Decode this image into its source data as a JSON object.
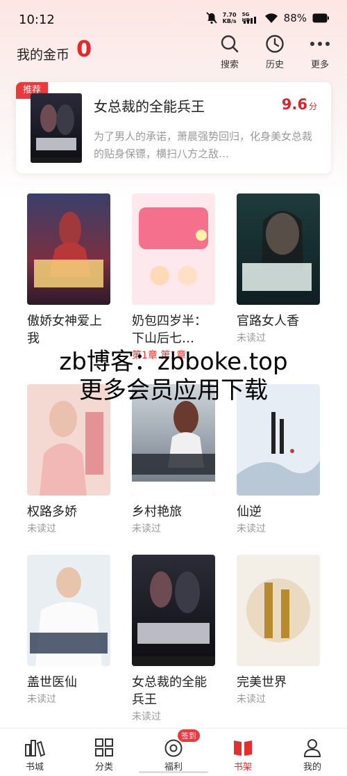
{
  "status_bar": {
    "time": "10:12",
    "net_speed_value": "7.70",
    "net_speed_unit": "KB/s",
    "signal_label": "5G HD",
    "battery": "88%"
  },
  "header": {
    "coin_label": "我的金币",
    "coin_count": "0",
    "search_label": "搜索",
    "history_label": "历史",
    "more_label": "更多"
  },
  "recommend": {
    "tag": "推荐",
    "title": "女总裁的全能兵王",
    "score": "9.6",
    "score_unit": "分",
    "description": "为了男人的承诺，萧晨强势回归，化身美女总裁的贴身保镖，横扫八方之敌…"
  },
  "books": [
    {
      "title": "傲娇女神爱上我",
      "status": ""
    },
    {
      "title": "奶包四岁半：下山后七…",
      "status": "第1章 第1章"
    },
    {
      "title": "官路女人香",
      "status": "未读过"
    },
    {
      "title": "权路多娇",
      "status": "未读过"
    },
    {
      "title": "乡村艳旅",
      "status": "未读过"
    },
    {
      "title": "仙逆",
      "status": "未读过"
    },
    {
      "title": "盖世医仙",
      "status": "未读过"
    },
    {
      "title": "女总裁的全能兵王",
      "status": "未读过"
    },
    {
      "title": "完美世界",
      "status": "未读过"
    }
  ],
  "watermark": {
    "line1": "zb博客：zbboke.top",
    "line2": "更多会员应用下载"
  },
  "bottom_nav": {
    "items": [
      {
        "label": "书城"
      },
      {
        "label": "分类"
      },
      {
        "label": "福利"
      },
      {
        "label": "书架"
      },
      {
        "label": "我的"
      }
    ],
    "sign_badge": "签到",
    "active_color": "#e2302f"
  },
  "colors": {
    "accent": "#e8393b",
    "score": "#d8262c",
    "muted": "#999999"
  }
}
